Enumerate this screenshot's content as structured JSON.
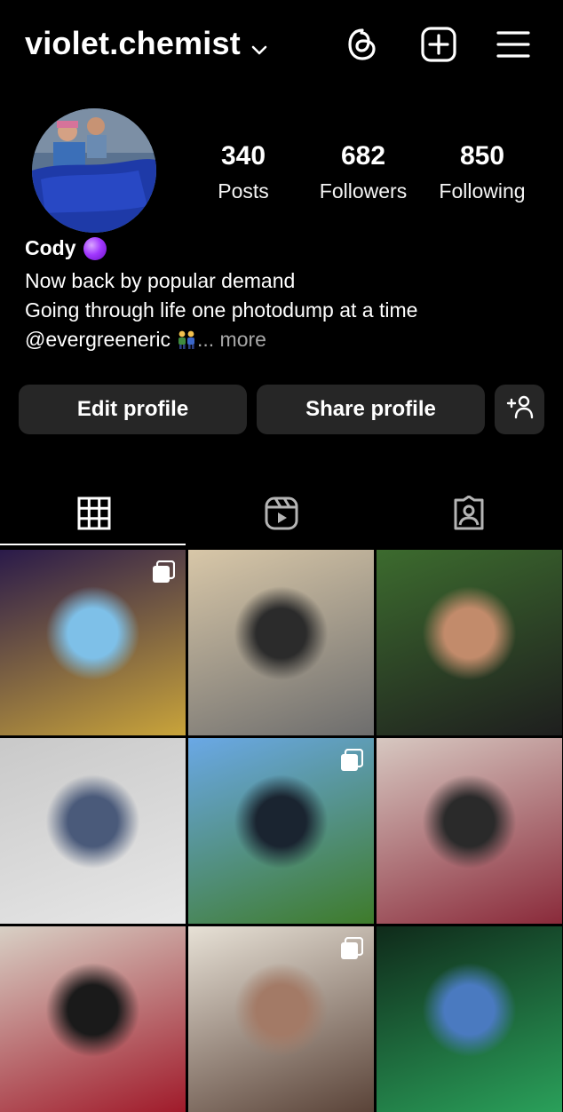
{
  "header": {
    "username": "violet.chemist",
    "icons": [
      "chevron-down-icon",
      "threads-icon",
      "create-icon",
      "menu-icon"
    ]
  },
  "profile": {
    "stats": {
      "posts": {
        "value": "340",
        "label": "Posts"
      },
      "followers": {
        "value": "682",
        "label": "Followers"
      },
      "following": {
        "value": "850",
        "label": "Following"
      }
    },
    "name": "Cody",
    "bio": {
      "line1": "Now back by popular demand",
      "line2": "Going through life one photodump at a time",
      "mention": "@evergreeneric",
      "more": "... more"
    }
  },
  "buttons": {
    "edit": "Edit profile",
    "share": "Share profile",
    "add_icon": "add-person-icon"
  },
  "tabs": [
    {
      "icon": "grid-icon",
      "active": true
    },
    {
      "icon": "reels-icon",
      "active": false
    },
    {
      "icon": "tagged-icon",
      "active": false
    }
  ],
  "grid": {
    "tiles": [
      {
        "multi": true,
        "colors": [
          "#2a1a4a",
          "#c9a43a",
          "#7ec0e8"
        ]
      },
      {
        "multi": false,
        "colors": [
          "#d8c7a8",
          "#6d6d6d",
          "#2b2b2b"
        ]
      },
      {
        "multi": false,
        "colors": [
          "#3c6b2e",
          "#1e1e1e",
          "#c28b6b"
        ]
      },
      {
        "multi": false,
        "colors": [
          "#c9c9c9",
          "#e7e7e7",
          "#4a5a7a"
        ]
      },
      {
        "multi": true,
        "colors": [
          "#6aa8e6",
          "#3e7b2a",
          "#1a2430"
        ]
      },
      {
        "multi": false,
        "colors": [
          "#d7c8c1",
          "#8a2a3a",
          "#2a2a2a"
        ]
      },
      {
        "multi": false,
        "colors": [
          "#d8d0c5",
          "#a01a2a",
          "#1a1a1a"
        ]
      },
      {
        "multi": true,
        "colors": [
          "#e7e1d6",
          "#5a4338",
          "#a37a66"
        ]
      },
      {
        "multi": false,
        "colors": [
          "#0f2a1a",
          "#2aa05a",
          "#4a7ac0"
        ]
      }
    ]
  },
  "colors": {
    "background": "#000000",
    "button_bg": "#262626",
    "muted_text": "#a8a8a8"
  }
}
